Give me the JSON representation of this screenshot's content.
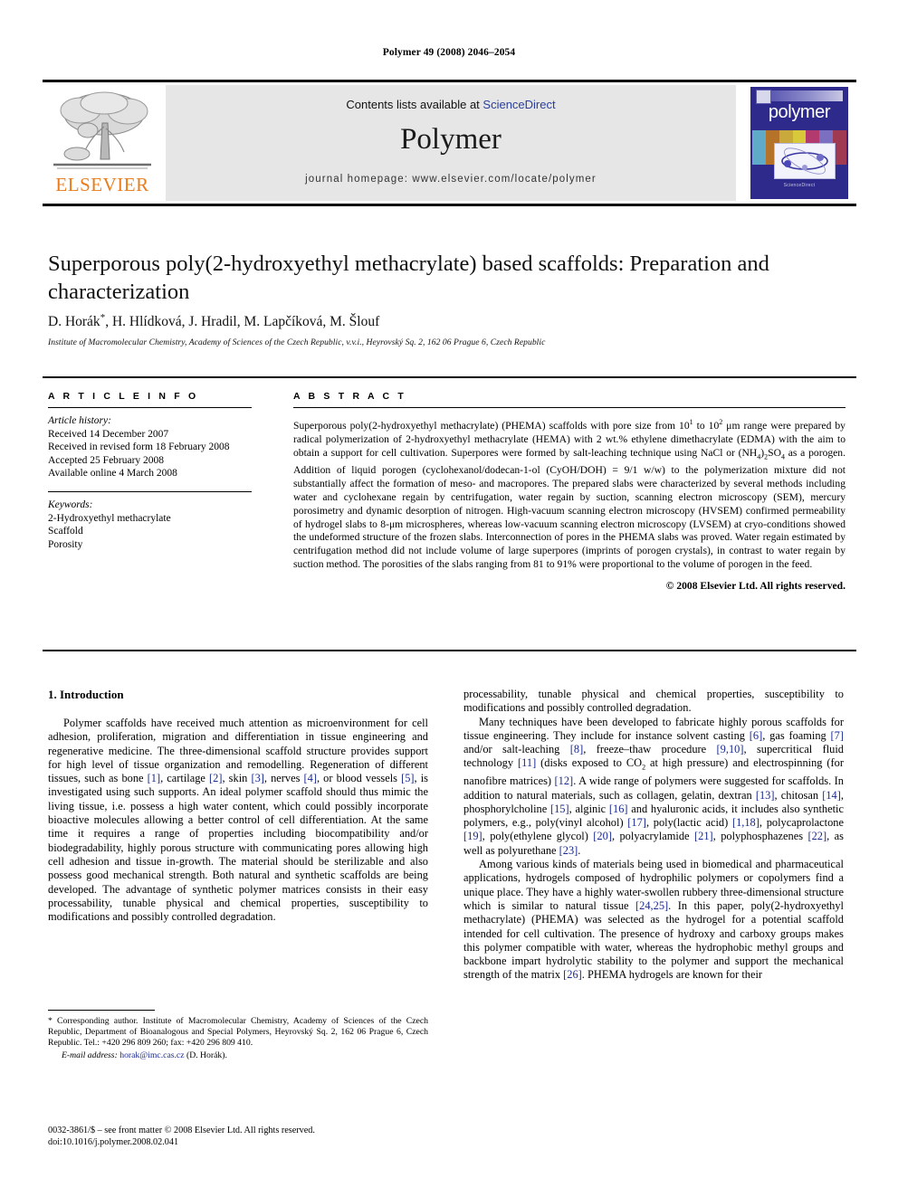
{
  "running_head": "Polymer 49 (2008) 2046–2054",
  "masthead": {
    "contents_prefix": "Contents lists available at ",
    "sciencedirect_link": "ScienceDirect",
    "journal_name": "Polymer",
    "homepage_line": "journal homepage: www.elsevier.com/locate/polymer",
    "publisher_logo_text": "ELSEVIER",
    "publisher_logo_color": "#E87D1E",
    "cover_title": "polymer",
    "cover_footer": "ScienceDirect",
    "link_color": "#2a3f9d"
  },
  "article": {
    "title": "Superporous poly(2-hydroxyethyl methacrylate) based scaffolds: Preparation and characterization",
    "authors": "D. Horák",
    "authors_rest": ", H. Hlídková, J. Hradil, M. Lapčíková, M. Šlouf",
    "corresponding_marker": "*",
    "affiliation": "Institute of Macromolecular Chemistry, Academy of Sciences of the Czech Republic, v.v.i., Heyrovský Sq. 2, 162 06 Prague 6, Czech Republic"
  },
  "article_info": {
    "heading": "A R T I C L E  I N F O",
    "history_label": "Article history:",
    "history": [
      "Received 14 December 2007",
      "Received in revised form 18 February 2008",
      "Accepted 25 February 2008",
      "Available online 4 March 2008"
    ],
    "keywords_label": "Keywords:",
    "keywords": [
      "2-Hydroxyethyl methacrylate",
      "Scaffold",
      "Porosity"
    ]
  },
  "abstract": {
    "heading": "A B S T R A C T",
    "part1": "Superporous poly(2-hydroxyethyl methacrylate) (PHEMA) scaffolds with pore size from 10",
    "sup1": "1",
    "part2": " to 10",
    "sup2": "2",
    "part3": " μm range were prepared by radical polymerization of 2-hydroxyethyl methacrylate (HEMA) with 2 wt.% ethylene dimethacrylate (EDMA) with the aim to obtain a support for cell cultivation. Superpores were formed by salt-leaching technique using NaCl or (NH",
    "sub1": "4",
    "part4": ")",
    "sub2": "2",
    "part5": "SO",
    "sub3": "4",
    "part6": " as a porogen. Addition of liquid porogen (cyclohexanol/dodecan-1-ol (CyOH/DOH) = 9/1 w/w) to the polymerization mixture did not substantially affect the formation of meso- and macropores. The prepared slabs were characterized by several methods including water and cyclohexane regain by centrifugation, water regain by suction, scanning electron microscopy (SEM), mercury porosimetry and dynamic desorption of nitrogen. High-vacuum scanning electron microscopy (HVSEM) confirmed permeability of hydrogel slabs to 8-μm microspheres, whereas low-vacuum scanning electron microscopy (LVSEM) at cryo-conditions showed the undeformed structure of the frozen slabs. Interconnection of pores in the PHEMA slabs was proved. Water regain estimated by centrifugation method did not include volume of large superpores (imprints of porogen crystals), in contrast to water regain by suction method. The porosities of the slabs ranging from 81 to 91% were proportional to the volume of porogen in the feed.",
    "copyright": "© 2008 Elsevier Ltd. All rights reserved."
  },
  "introduction": {
    "section_number_title": "1. Introduction",
    "left_p1_a": "Polymer scaffolds have received much attention as microenvironment for cell adhesion, proliferation, migration and differentiation in tissue engineering and regenerative medicine. The three-dimensional scaffold structure provides support for high level of tissue organization and remodelling. Regeneration of different tissues, such as bone ",
    "ref1": "[1]",
    "left_p1_b": ", cartilage ",
    "ref2": "[2]",
    "left_p1_c": ", skin ",
    "ref3": "[3]",
    "left_p1_d": ", nerves ",
    "ref4": "[4]",
    "left_p1_e": ", or blood vessels ",
    "ref5": "[5]",
    "left_p1_f": ", is investigated using such supports. An ideal polymer scaffold should thus mimic the living tissue, i.e. possess a high water content, which could possibly incorporate bioactive molecules allowing a better control of cell differentiation. At the same time it requires a range of properties including biocompatibility and/or biodegradability, highly porous structure with communicating pores allowing high cell adhesion and tissue in-growth. The material should be sterilizable and also possess good mechanical strength. Both natural and synthetic scaffolds are being developed. The advantage of synthetic polymer matrices consists in their easy processability, tunable physical and chemical properties, susceptibility to modifications and possibly controlled degradation.",
    "right_p1_tail": "processability, tunable physical and chemical properties, susceptibility to modifications and possibly controlled degradation.",
    "right_p2_a": "Many techniques have been developed to fabricate highly porous scaffolds for tissue engineering. They include for instance solvent casting ",
    "ref6": "[6]",
    "right_p2_b": ", gas foaming ",
    "ref7": "[7]",
    "right_p2_c": " and/or salt-leaching ",
    "ref8": "[8]",
    "right_p2_d": ", freeze–thaw procedure ",
    "ref910": "[9,10]",
    "right_p2_e": ", supercritical fluid technology ",
    "ref11": "[11]",
    "right_p2_f": " (disks exposed to CO",
    "co2_sub": "2",
    "right_p2_g": " at high pressure) and electrospinning (for nanofibre matrices) ",
    "ref12": "[12]",
    "right_p2_h": ". A wide range of polymers were suggested for scaffolds. In addition to natural materials, such as collagen, gelatin, dextran ",
    "ref13": "[13]",
    "right_p2_i": ", chitosan ",
    "ref14": "[14]",
    "right_p2_j": ", phosphorylcholine ",
    "ref15": "[15]",
    "right_p2_k": ", alginic ",
    "ref16": "[16]",
    "right_p2_l": " and hyaluronic acids, it includes also synthetic polymers, e.g., poly(vinyl alcohol) ",
    "ref17": "[17]",
    "right_p2_m": ", poly(lactic acid) ",
    "ref118": "[1,18]",
    "right_p2_n": ", polycaprolactone ",
    "ref19": "[19]",
    "right_p2_o": ", poly(ethylene glycol) ",
    "ref20": "[20]",
    "right_p2_p": ", polyacrylamide ",
    "ref21": "[21]",
    "right_p2_q": ", polyphosphazenes ",
    "ref22": "[22]",
    "right_p2_r": ", as well as polyurethane ",
    "ref23": "[23]",
    "right_p2_s": ".",
    "right_p3_a": "Among various kinds of materials being used in biomedical and pharmaceutical applications, hydrogels composed of hydrophilic polymers or copolymers find a unique place. They have a highly water-swollen rubbery three-dimensional structure which is similar to natural tissue ",
    "ref2425": "[24,25]",
    "right_p3_b": ". In this paper, poly(2-hydroxyethyl methacrylate) (PHEMA) was selected as the hydrogel for a potential scaffold intended for cell cultivation. The presence of hydroxy and carboxy groups makes this polymer compatible with water, whereas the hydrophobic methyl groups and backbone impart hydrolytic stability to the polymer and support the mechanical strength of the matrix ",
    "ref26": "[26]",
    "right_p3_c": ". PHEMA hydrogels are known for their"
  },
  "footnote": {
    "text": "* Corresponding author. Institute of Macromolecular Chemistry, Academy of Sciences of the Czech Republic, Department of Bioanalogous and Special Polymers, Heyrovský Sq. 2, 162 06 Prague 6, Czech Republic. Tel.: +420 296 809 260; fax: +420 296 809 410.",
    "email_label": "E-mail address:",
    "email": "horak@imc.cas.cz",
    "email_suffix": "(D. Horák)."
  },
  "imprint": {
    "line1": "0032-3861/$ – see front matter © 2008 Elsevier Ltd. All rights reserved.",
    "line2": "doi:10.1016/j.polymer.2008.02.041"
  }
}
